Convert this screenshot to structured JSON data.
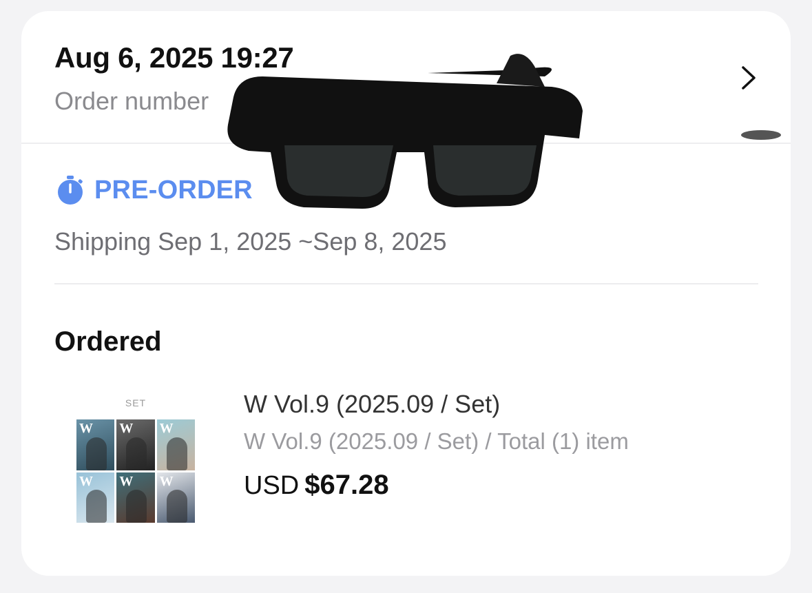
{
  "order": {
    "date_time": "Aug 6, 2025 19:27",
    "number_label": "Order number"
  },
  "status": {
    "label": "PRE-ORDER",
    "icon": "stopwatch-icon",
    "shipping_text": "Shipping Sep 1, 2025 ~Sep 8, 2025",
    "accent_color": "#5b8def"
  },
  "ordered": {
    "section_title": "Ordered",
    "items": [
      {
        "thumbnail_label": "SET",
        "name": "W Vol.9 (2025.09 / Set)",
        "detail": "W Vol.9 (2025.09 / Set) / Total (1) item",
        "currency": "USD",
        "price": "$67.28"
      }
    ]
  },
  "icons": [
    "chevron-right-icon",
    "stopwatch-icon"
  ]
}
